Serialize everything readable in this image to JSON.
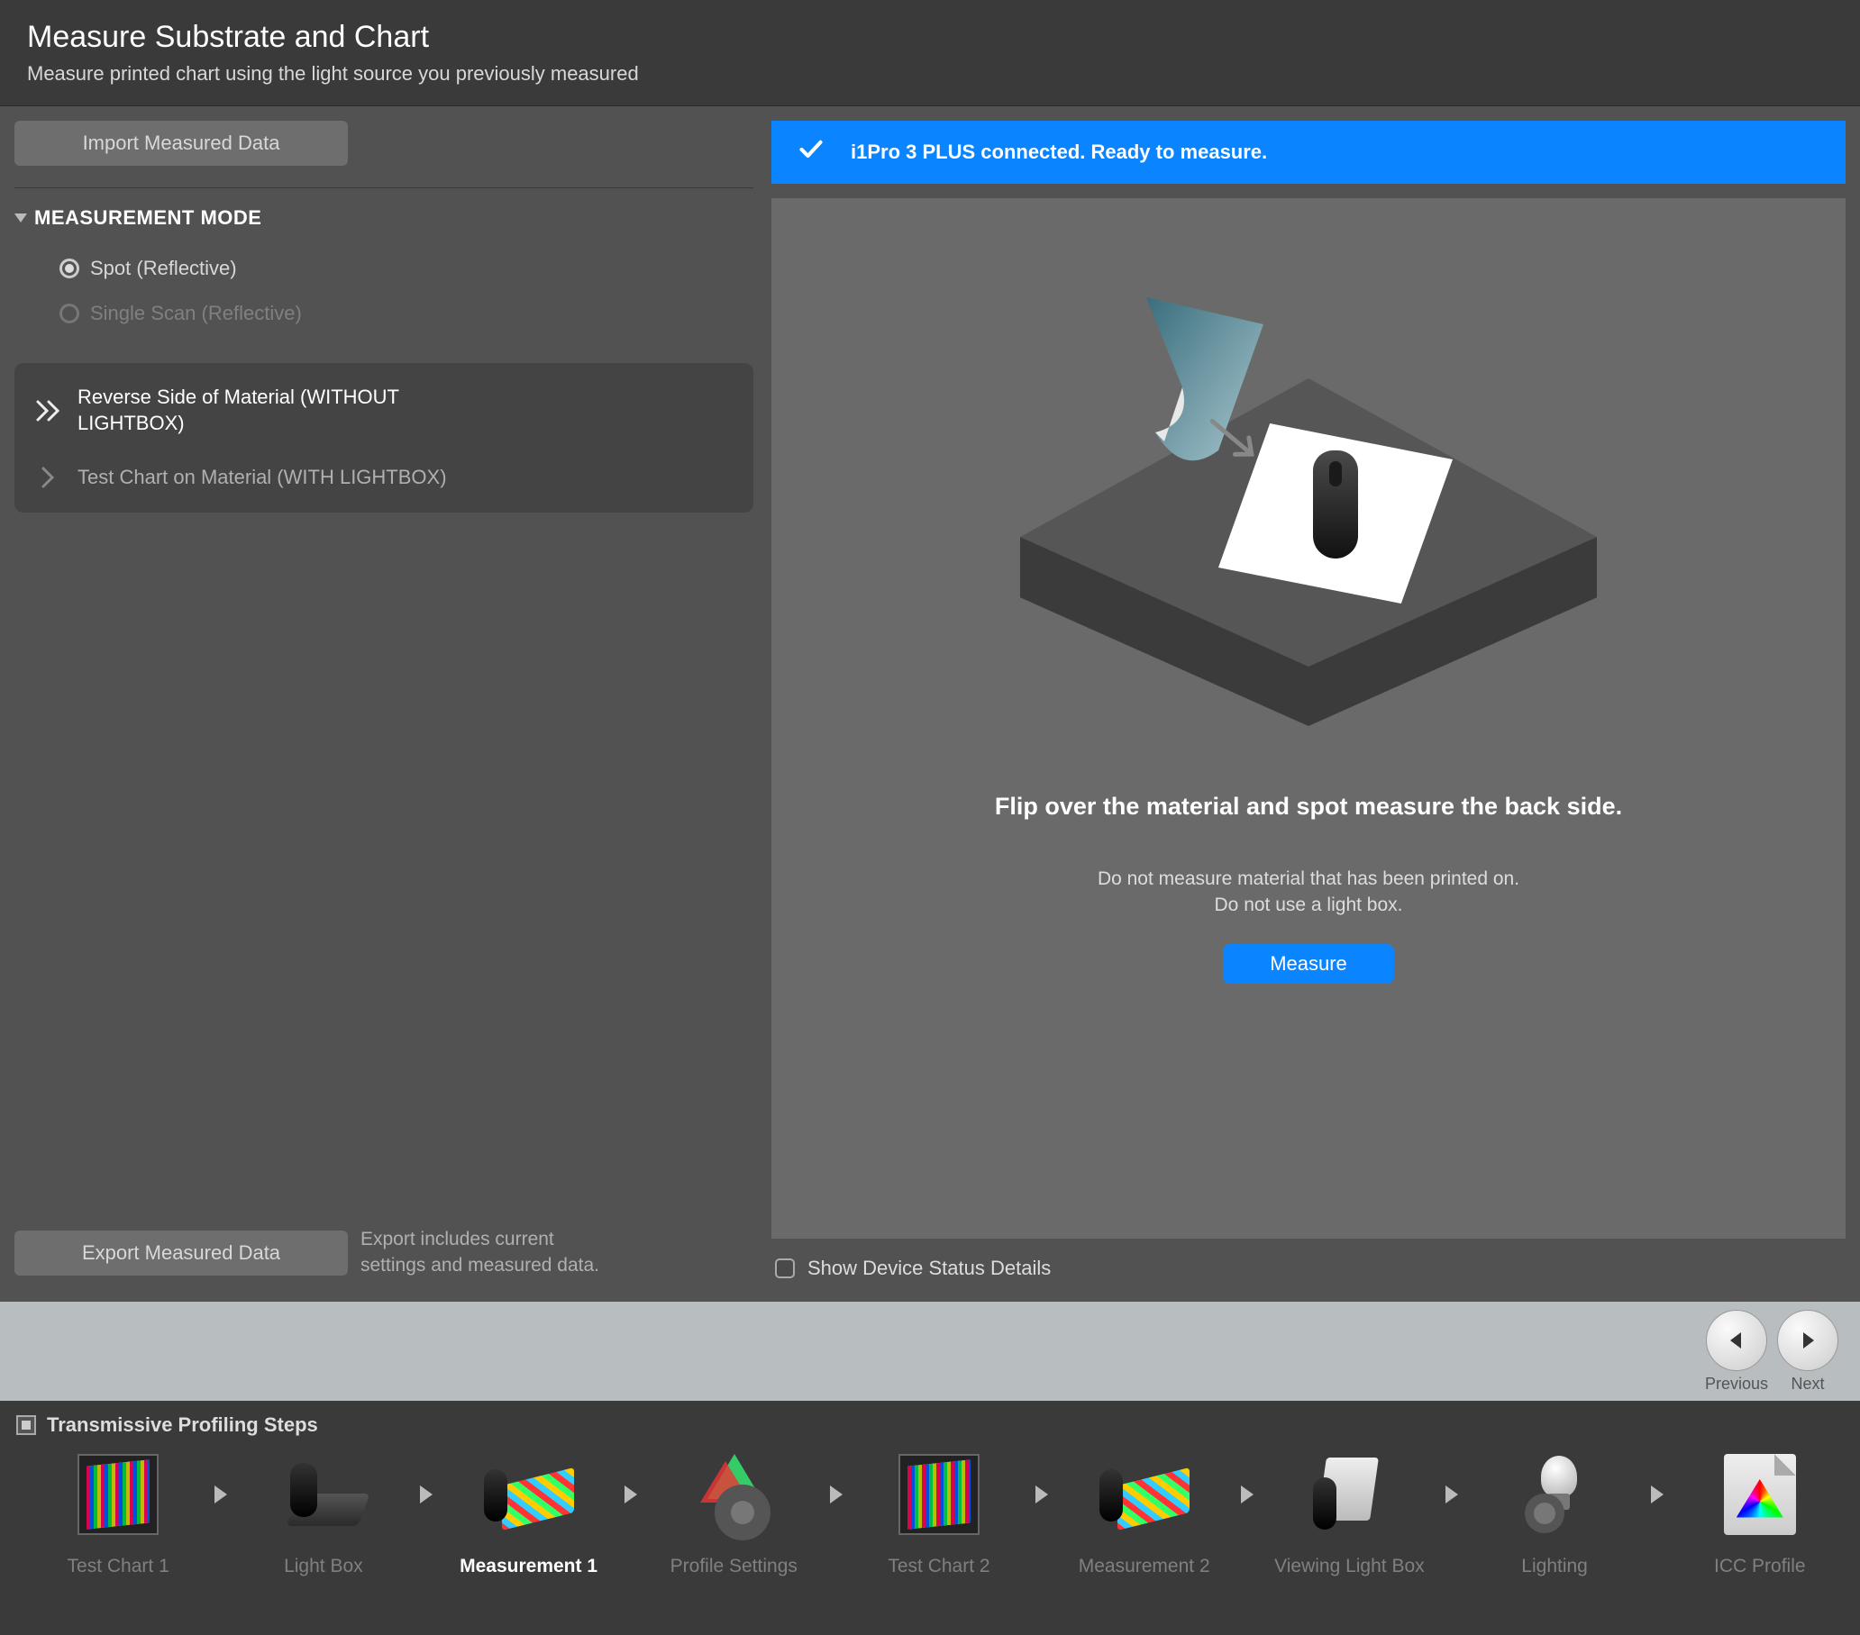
{
  "header": {
    "title": "Measure Substrate and Chart",
    "subtitle": "Measure printed chart using the light source you previously measured"
  },
  "sidebar": {
    "import_btn": "Import Measured Data",
    "mode_section": "MEASUREMENT MODE",
    "radio_spot": "Spot (Reflective)",
    "radio_scan": "Single Scan (Reflective)",
    "task_reverse": "Reverse Side of Material (WITHOUT LIGHTBOX)",
    "task_testchart": "Test Chart on Material (WITH LIGHTBOX)",
    "export_btn": "Export Measured Data",
    "export_desc": "Export includes current settings and measured data."
  },
  "status": {
    "text": "i1Pro 3 PLUS connected. Ready to measure."
  },
  "stage": {
    "instruction": "Flip over the material and spot measure the back side.",
    "warn1": "Do not measure material that has been printed on.",
    "warn2": "Do not use a light box.",
    "measure_btn": "Measure",
    "show_details": "Show Device Status Details"
  },
  "nav": {
    "prev": "Previous",
    "next": "Next"
  },
  "steps": {
    "heading": "Transmissive Profiling Steps",
    "items": [
      "Test Chart 1",
      "Light Box",
      "Measurement 1",
      "Profile Settings",
      "Test Chart 2",
      "Measurement 2",
      "Viewing Light Box",
      "Lighting",
      "ICC Profile"
    ],
    "active_index": 2
  }
}
